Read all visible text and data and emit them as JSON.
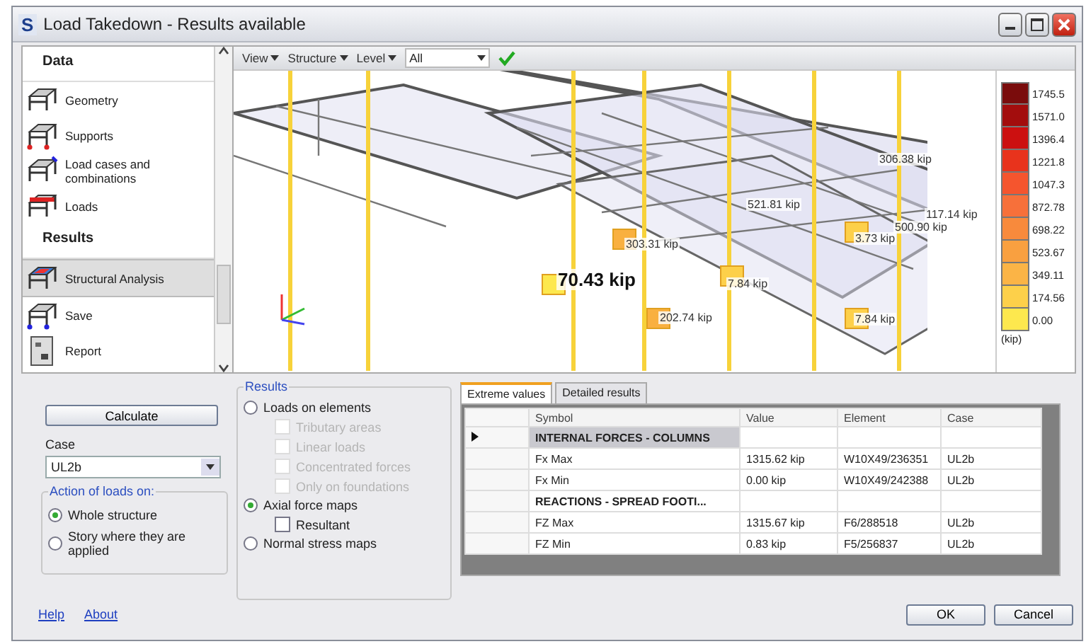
{
  "window": {
    "app_letter": "S",
    "title": "Load Takedown - Results available"
  },
  "sidebar": {
    "sections": [
      {
        "title": "Data",
        "items": [
          {
            "label": "Geometry",
            "selected": false
          },
          {
            "label": "Supports",
            "selected": false
          },
          {
            "label": "Load cases and combinations",
            "selected": false
          },
          {
            "label": "Loads",
            "selected": false
          }
        ]
      },
      {
        "title": "Results",
        "items": [
          {
            "label": "Structural Analysis",
            "selected": true
          },
          {
            "label": "Save",
            "selected": false
          },
          {
            "label": "Report",
            "selected": false
          }
        ]
      }
    ]
  },
  "toolbar": {
    "menus": [
      "View",
      "Structure",
      "Level"
    ],
    "level_value": "All"
  },
  "viewer": {
    "labels": [
      {
        "text": "306.38 kip",
        "emphasis": false
      },
      {
        "text": "521.81 kip",
        "emphasis": false
      },
      {
        "text": "117.14 kip",
        "emphasis": false
      },
      {
        "text": "500.90 kip",
        "emphasis": false
      },
      {
        "text": "303.31 kip",
        "emphasis": false
      },
      {
        "text": "3.73 kip",
        "emphasis": false
      },
      {
        "text": "70.43 kip",
        "emphasis": true
      },
      {
        "text": "7.84 kip",
        "emphasis": false
      },
      {
        "text": "202.74 kip",
        "emphasis": false
      },
      {
        "text": "7.84 kip",
        "emphasis": false
      }
    ],
    "legend": {
      "unit": "(kip)",
      "steps": [
        {
          "value": "1745.5",
          "color": "#7a0c0c"
        },
        {
          "value": "1571.0",
          "color": "#a30d0d"
        },
        {
          "value": "1396.4",
          "color": "#cc1010"
        },
        {
          "value": "1221.8",
          "color": "#e8331c"
        },
        {
          "value": "1047.3",
          "color": "#f5552e"
        },
        {
          "value": "872.78",
          "color": "#f7703a"
        },
        {
          "value": "698.22",
          "color": "#f88a3c"
        },
        {
          "value": "523.67",
          "color": "#f9a040"
        },
        {
          "value": "349.11",
          "color": "#fbb446"
        },
        {
          "value": "174.56",
          "color": "#fdd04a"
        },
        {
          "value": "0.00",
          "color": "#fde84e"
        }
      ]
    }
  },
  "controls": {
    "calculate": "Calculate",
    "case_label": "Case",
    "case_value": "UL2b",
    "action_group": {
      "title": "Action of loads on:",
      "options": [
        {
          "label": "Whole structure",
          "selected": true
        },
        {
          "label": "Story where they are applied",
          "selected": false
        }
      ]
    }
  },
  "results_group": {
    "title": "Results",
    "options": [
      {
        "kind": "radio",
        "label": "Loads on elements",
        "selected": false
      },
      {
        "kind": "checkbox",
        "label": "Tributary areas",
        "checked": false,
        "disabled": true
      },
      {
        "kind": "checkbox",
        "label": "Linear loads",
        "checked": false,
        "disabled": true
      },
      {
        "kind": "checkbox",
        "label": "Concentrated forces",
        "checked": false,
        "disabled": true
      },
      {
        "kind": "checkbox",
        "label": "Only on foundations",
        "checked": false,
        "disabled": true
      },
      {
        "kind": "radio",
        "label": "Axial force maps",
        "selected": true
      },
      {
        "kind": "checkbox",
        "label": "Resultant",
        "checked": false,
        "disabled": false
      },
      {
        "kind": "radio",
        "label": "Normal stress maps",
        "selected": false
      }
    ]
  },
  "result_tabs": [
    {
      "label": "Extreme values",
      "selected": true
    },
    {
      "label": "Detailed results",
      "selected": false
    }
  ],
  "table": {
    "columns": [
      "Symbol",
      "Value",
      "Element",
      "Case"
    ],
    "rows": [
      {
        "kind": "group",
        "current": true,
        "cells": [
          "INTERNAL FORCES - COLUMNS"
        ]
      },
      {
        "kind": "data",
        "current": false,
        "cells": [
          "Fx Max",
          "1315.62 kip",
          "W10X49/236351",
          "UL2b"
        ]
      },
      {
        "kind": "data",
        "current": false,
        "cells": [
          "Fx Min",
          "0.00 kip",
          "W10X49/242388",
          "UL2b"
        ]
      },
      {
        "kind": "group",
        "current": false,
        "cells": [
          "REACTIONS - SPREAD FOOTI..."
        ]
      },
      {
        "kind": "data",
        "current": false,
        "cells": [
          "FZ Max",
          "1315.67 kip",
          "F6/288518",
          "UL2b"
        ]
      },
      {
        "kind": "data",
        "current": false,
        "cells": [
          "FZ Min",
          "0.83 kip",
          "F5/256837",
          "UL2b"
        ]
      }
    ]
  },
  "footer": {
    "links": [
      "Help",
      "About"
    ],
    "buttons": [
      "OK",
      "Cancel"
    ]
  }
}
